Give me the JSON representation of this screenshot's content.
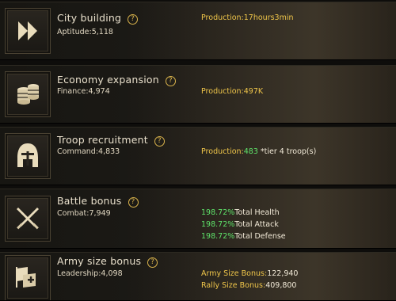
{
  "rows": [
    {
      "title": "City building",
      "stat": "Aptitude:5,118",
      "icon": "double-arrow-icon",
      "lines": [
        {
          "label": "Production:",
          "value": "17hours3min"
        }
      ]
    },
    {
      "title": "Economy expansion",
      "stat": "Finance:4,974",
      "icon": "coin-stack-icon",
      "lines": [
        {
          "label": "Production:",
          "value": "497K"
        }
      ]
    },
    {
      "title": "Troop recruitment",
      "stat": "Command:4,833",
      "icon": "helmet-icon",
      "lines": [
        {
          "label": "Production:",
          "value": "483",
          "suffix": " *tier 4 troop(s)"
        }
      ]
    },
    {
      "title": "Battle bonus",
      "stat": "Combat:7,949",
      "icon": "crossed-swords-icon",
      "lines": [
        {
          "value": "198.72%",
          "label": "Total Health"
        },
        {
          "value": "198.72%",
          "label": "Total Attack"
        },
        {
          "value": "198.72%",
          "label": "Total Defense"
        }
      ]
    },
    {
      "title": "Army size bonus",
      "stat": "Leadership:4,098",
      "icon": "flag-plus-icon",
      "lines": [
        {
          "label": "Army Size Bonus:",
          "value": "122,940"
        },
        {
          "label": "Rally Size Bonus:",
          "value": "409,800"
        }
      ]
    }
  ],
  "help_symbol": "?",
  "colors": {
    "gold": "#f0c64a",
    "green": "#5fe36a",
    "cream": "#e9e0cc"
  }
}
